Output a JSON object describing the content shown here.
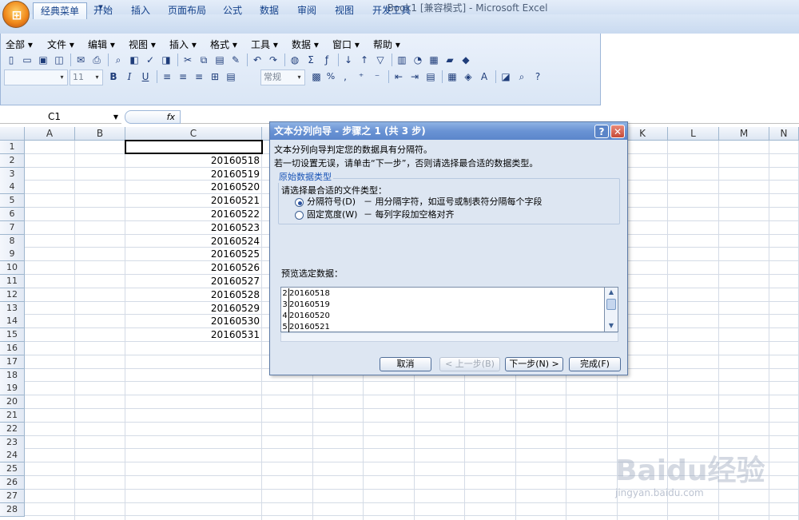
{
  "window": {
    "title": "Book1  [兼容模式] - Microsoft Excel"
  },
  "qat": {
    "icons": [
      "save-icon",
      "undo-icon",
      "redo-icon",
      "customize-icon"
    ]
  },
  "ribbon": {
    "tabs": [
      "经典菜单",
      "开始",
      "插入",
      "页面布局",
      "公式",
      "数据",
      "审阅",
      "视图",
      "开发工具"
    ],
    "menu": [
      "全部",
      "文件",
      "编辑",
      "视图",
      "插入",
      "格式",
      "工具",
      "数据",
      "窗口",
      "帮助"
    ],
    "font_size": "11",
    "number_format": "常规"
  },
  "formula_bar": {
    "name_box": "C1",
    "fx": "fx",
    "value": ""
  },
  "grid": {
    "columns": [
      "A",
      "B",
      "C",
      "D",
      "E",
      "F",
      "G",
      "H",
      "I",
      "J",
      "K",
      "L",
      "M",
      "N"
    ],
    "rows": [
      "1",
      "2",
      "3",
      "4",
      "5",
      "6",
      "7",
      "8",
      "9",
      "10",
      "11",
      "12",
      "13",
      "14",
      "15",
      "16",
      "17",
      "18",
      "19",
      "20",
      "21",
      "22",
      "23",
      "24",
      "25",
      "26",
      "27",
      "28"
    ],
    "c_values": [
      "",
      "20160518",
      "20160519",
      "20160520",
      "20160521",
      "20160522",
      "20160523",
      "20160524",
      "20160525",
      "20160526",
      "20160527",
      "20160528",
      "20160529",
      "20160530",
      "20160531"
    ]
  },
  "dialog": {
    "title": "文本分列向导 - 步骤之 1 (共 3 步)",
    "help": "?",
    "close": "✕",
    "line1": "文本分列向导判定您的数据具有分隔符。",
    "line2": "若一切设置无误，请单击“下一步”，否则请选择最合适的数据类型。",
    "group_label": "原始数据类型",
    "choose_label": "请选择最合适的文件类型：",
    "opt1_label": "分隔符号(D)",
    "opt1_desc": "－ 用分隔字符，如逗号或制表符分隔每个字段",
    "opt2_label": "固定宽度(W)",
    "opt2_desc": "－ 每列字段加空格对齐",
    "preview_label": "预览选定数据：",
    "preview_rows": [
      {
        "n": "2",
        "v": "20160518"
      },
      {
        "n": "3",
        "v": "20160519"
      },
      {
        "n": "4",
        "v": "20160520"
      },
      {
        "n": "5",
        "v": "20160521"
      }
    ],
    "buttons": {
      "cancel": "取消",
      "back": "< 上一步(B)",
      "next": "下一步(N) >",
      "finish": "完成(F)"
    }
  },
  "watermark": {
    "brand": "Baidu经验",
    "url": "jingyan.baidu.com"
  }
}
